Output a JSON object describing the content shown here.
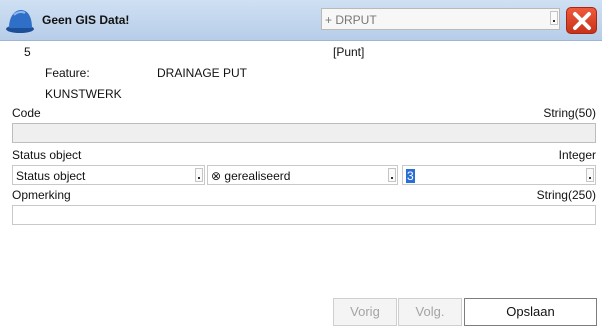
{
  "header": {
    "title": "Geen GIS Data!",
    "type_select": "+ DRPUT",
    "close_label": "X",
    "icon": "helmet-icon"
  },
  "feature": {
    "id": "5",
    "geometry": "[Punt]",
    "feature_label": "Feature:",
    "feature_value": "DRAINAGE PUT",
    "category": "KUNSTWERK"
  },
  "fields": {
    "code": {
      "label": "Code",
      "type": "String(50)",
      "value": ""
    },
    "status": {
      "label": "Status object",
      "type": "Integer",
      "select1": "Status object",
      "select2": "⊗ gerealiseerd",
      "select3": "3"
    },
    "opmerking": {
      "label": "Opmerking",
      "type": "String(250)",
      "value": ""
    }
  },
  "buttons": {
    "prev": "Vorig",
    "next": "Volg.",
    "save": "Opslaan"
  },
  "colors": {
    "title_bar": "#c4d7ee",
    "close": "#d9401f",
    "selection": "#2b6fd6"
  }
}
